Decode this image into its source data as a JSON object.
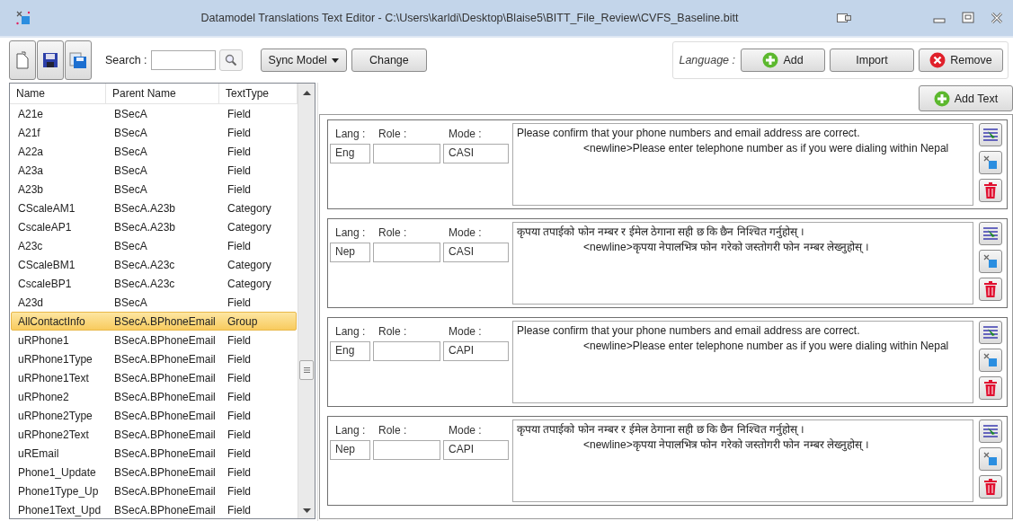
{
  "window": {
    "title": "Datamodel Translations Text Editor - C:\\Users\\karldi\\Desktop\\Blaise5\\BITT_File_Review\\CVFS_Baseline.bitt"
  },
  "toolbar": {
    "search_label": "Search :",
    "sync_button": "Sync Model",
    "change_button": "Change"
  },
  "language": {
    "label": "Language :",
    "buttons": [
      {
        "kind": "add",
        "label": "Add"
      },
      {
        "kind": "plain",
        "label": "Import"
      },
      {
        "kind": "remove",
        "label": "Remove"
      }
    ]
  },
  "list": {
    "columns": [
      "Name",
      "Parent Name",
      "TextType"
    ],
    "rows": [
      {
        "cells": [
          "A21e",
          "BSecA",
          "Field"
        ],
        "selected": false
      },
      {
        "cells": [
          "A21f",
          "BSecA",
          "Field"
        ],
        "selected": false
      },
      {
        "cells": [
          "A22a",
          "BSecA",
          "Field"
        ],
        "selected": false
      },
      {
        "cells": [
          "A23a",
          "BSecA",
          "Field"
        ],
        "selected": false
      },
      {
        "cells": [
          "A23b",
          "BSecA",
          "Field"
        ],
        "selected": false
      },
      {
        "cells": [
          "CScaleAM1",
          "BSecA.A23b",
          "Category"
        ],
        "selected": false
      },
      {
        "cells": [
          "CscaleAP1",
          "BSecA.A23b",
          "Category"
        ],
        "selected": false
      },
      {
        "cells": [
          "A23c",
          "BSecA",
          "Field"
        ],
        "selected": false
      },
      {
        "cells": [
          "CScaleBM1",
          "BSecA.A23c",
          "Category"
        ],
        "selected": false
      },
      {
        "cells": [
          "CscaleBP1",
          "BSecA.A23c",
          "Category"
        ],
        "selected": false
      },
      {
        "cells": [
          "A23d",
          "BSecA",
          "Field"
        ],
        "selected": false
      },
      {
        "cells": [
          "AllContactInfo",
          "BSecA.BPhoneEmail",
          "Group"
        ],
        "selected": true
      },
      {
        "cells": [
          "uRPhone1",
          "BSecA.BPhoneEmail",
          "Field"
        ],
        "selected": false
      },
      {
        "cells": [
          "uRPhone1Type",
          "BSecA.BPhoneEmail",
          "Field"
        ],
        "selected": false
      },
      {
        "cells": [
          "uRPhone1Text",
          "BSecA.BPhoneEmail",
          "Field"
        ],
        "selected": false
      },
      {
        "cells": [
          "uRPhone2",
          "BSecA.BPhoneEmail",
          "Field"
        ],
        "selected": false
      },
      {
        "cells": [
          "uRPhone2Type",
          "BSecA.BPhoneEmail",
          "Field"
        ],
        "selected": false
      },
      {
        "cells": [
          "uRPhone2Text",
          "BSecA.BPhoneEmail",
          "Field"
        ],
        "selected": false
      },
      {
        "cells": [
          "uREmail",
          "BSecA.BPhoneEmail",
          "Field"
        ],
        "selected": false
      },
      {
        "cells": [
          "Phone1_Update",
          "BSecA.BPhoneEmail",
          "Field"
        ],
        "selected": false
      },
      {
        "cells": [
          "Phone1Type_Up",
          "BSecA.BPhoneEmail",
          "Field"
        ],
        "selected": false
      },
      {
        "cells": [
          "Phone1Text_Upd",
          "BSecA.BPhoneEmail",
          "Field"
        ],
        "selected": false
      }
    ]
  },
  "add_text_button": "Add Text",
  "texts": [
    {
      "lang_label": "Lang :",
      "role_label": "Role :",
      "mode_label": "Mode :",
      "lang": "Eng",
      "mode": "CASI",
      "lines": [
        "Please confirm that your phone numbers and email address are correct.",
        "<newline>Please enter telephone number as if you were dialing within Nepal"
      ]
    },
    {
      "lang_label": "Lang :",
      "role_label": "Role :",
      "mode_label": "Mode :",
      "lang": "Nep",
      "mode": "CASI",
      "lines": [
        "कृपया तपाईको फोन नम्बर र ईमेल ठेगाना सही छ कि छैन निश्चित गर्नुहोस् ।",
        "<newline>कृपया नेपालभित्र फोन गरेको जस्तोगरी फोन नम्बर लेख्नुहोस् ।"
      ]
    },
    {
      "lang_label": "Lang :",
      "role_label": "Role :",
      "mode_label": "Mode :",
      "lang": "Eng",
      "mode": "CAPI",
      "lines": [
        "Please confirm that your phone numbers and email address are correct.",
        "<newline>Please enter telephone number as if you were dialing within Nepal"
      ]
    },
    {
      "lang_label": "Lang :",
      "role_label": "Role :",
      "mode_label": "Mode :",
      "lang": "Nep",
      "mode": "CAPI",
      "lines": [
        "कृपया तपाईको फोन नम्बर र ईमेल ठेगाना सही छ कि छैन निश्चित गर्नुहोस् ।",
        "<newline>कृपया नेपालभित्र फोन गरेको जस्तोगरी फोन नम्बर लेख्नुहोस् ।"
      ]
    }
  ]
}
